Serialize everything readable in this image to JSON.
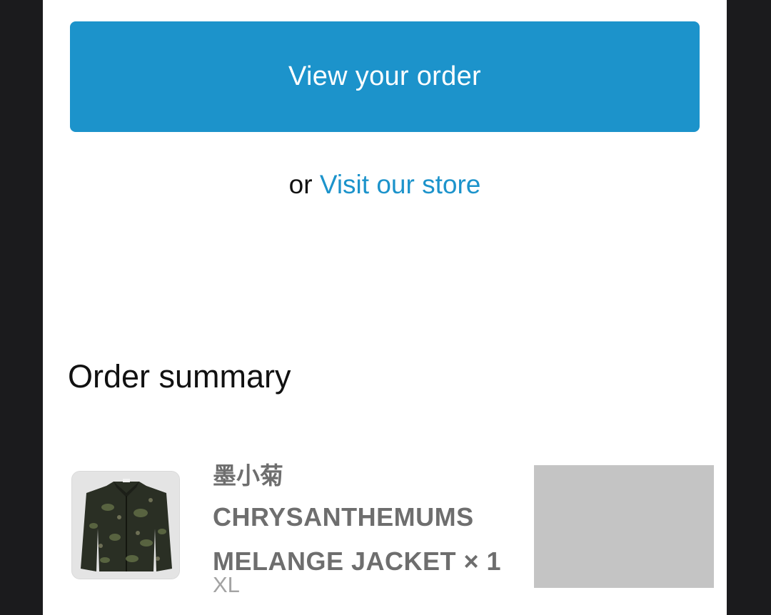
{
  "actions": {
    "view_order_label": "View your order",
    "or_text": "or",
    "visit_store_label": "Visit our store",
    "accent_color": "#1c93cb"
  },
  "order_summary": {
    "title": "Order summary",
    "items": [
      {
        "brand": "墨小菊",
        "name": "CHRYSANTHEMUMS MELANGE JACKET × 1",
        "variant": "XL",
        "thumbnail": "jacket-image"
      }
    ]
  }
}
